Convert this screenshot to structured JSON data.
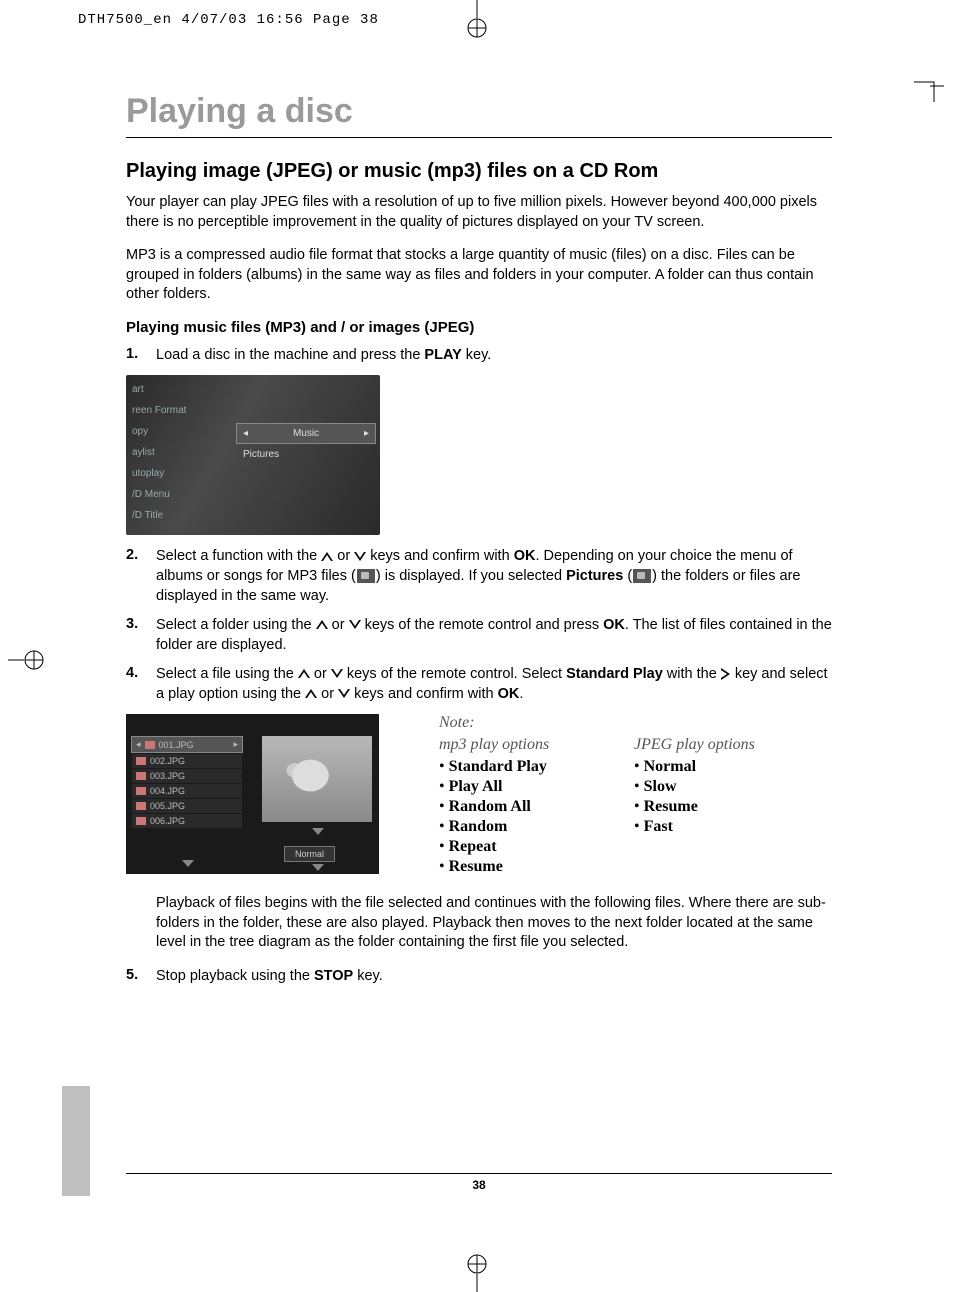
{
  "print_header": "DTH7500_en  4/07/03  16:56  Page 38",
  "title": "Playing a disc",
  "section": "Playing image (JPEG) or music (mp3) files on a CD Rom",
  "para1": "Your player can play JPEG files with a resolution of up to five million pixels. However beyond 400,000 pixels there is no perceptible improvement in the quality of pictures displayed on your TV screen.",
  "para2": "MP3 is a compressed audio file format that stocks a large quantity of music (files) on a disc. Files can be grouped in folders (albums) in the same way as files and folders in your computer. A folder can thus contain other folders.",
  "sub": "Playing music files (MP3) and / or images (JPEG)",
  "steps": {
    "s1_a": "Load a disc in the machine and press the ",
    "s1_b": "PLAY",
    "s1_c": " key.",
    "s2_a": "Select a function with the ",
    "s2_b": " or ",
    "s2_c": " keys and confirm with ",
    "s2_d": "OK",
    "s2_e": ". Depending on your choice the menu of albums or songs for MP3 files (",
    "s2_f": ") is displayed. If you selected ",
    "s2_g": "Pictures",
    "s2_h": " (",
    "s2_i": ") the folders or files are displayed in the same way.",
    "s3_a": "Select a folder using the ",
    "s3_b": " or ",
    "s3_c": " keys of the remote control and press ",
    "s3_d": "OK",
    "s3_e": ". The list of files contained in the folder are displayed.",
    "s4_a": "Select a file using the ",
    "s4_b": " or ",
    "s4_c": " keys of the remote control. Select ",
    "s4_d": "Standard Play",
    "s4_e": " with the ",
    "s4_f": " key and select a play option using the ",
    "s4_g": " or ",
    "s4_h": " keys and confirm with ",
    "s4_i": "OK",
    "s4_j": ".",
    "playback": "Playback of files begins with the file selected and continues with the following files. Where there are sub-folders in the folder, these are also played. Playback then moves to the next folder located at the same level in the tree diagram as the folder containing the first file you selected.",
    "s5_a": "Stop playback using the ",
    "s5_b": "STOP",
    "s5_c": " key."
  },
  "menu1": {
    "left": [
      "art",
      "reen Format",
      "opy",
      "aylist",
      "utoplay",
      "/D Menu",
      "/D Title"
    ],
    "right_sel": "Music",
    "right_2": "Pictures"
  },
  "menu2": {
    "files": [
      "001.JPG",
      "002.JPG",
      "003.JPG",
      "004.JPG",
      "005.JPG",
      "006.JPG"
    ],
    "normal": "Normal"
  },
  "options": {
    "note": "Note:",
    "mp3_head": "mp3 play options",
    "mp3": [
      "Standard Play",
      "Play All",
      "Random All",
      "Random",
      "Repeat",
      "Resume"
    ],
    "jpeg_head": "JPEG play options",
    "jpeg": [
      "Normal",
      "Slow",
      "Resume",
      "Fast"
    ]
  },
  "page_number": "38"
}
